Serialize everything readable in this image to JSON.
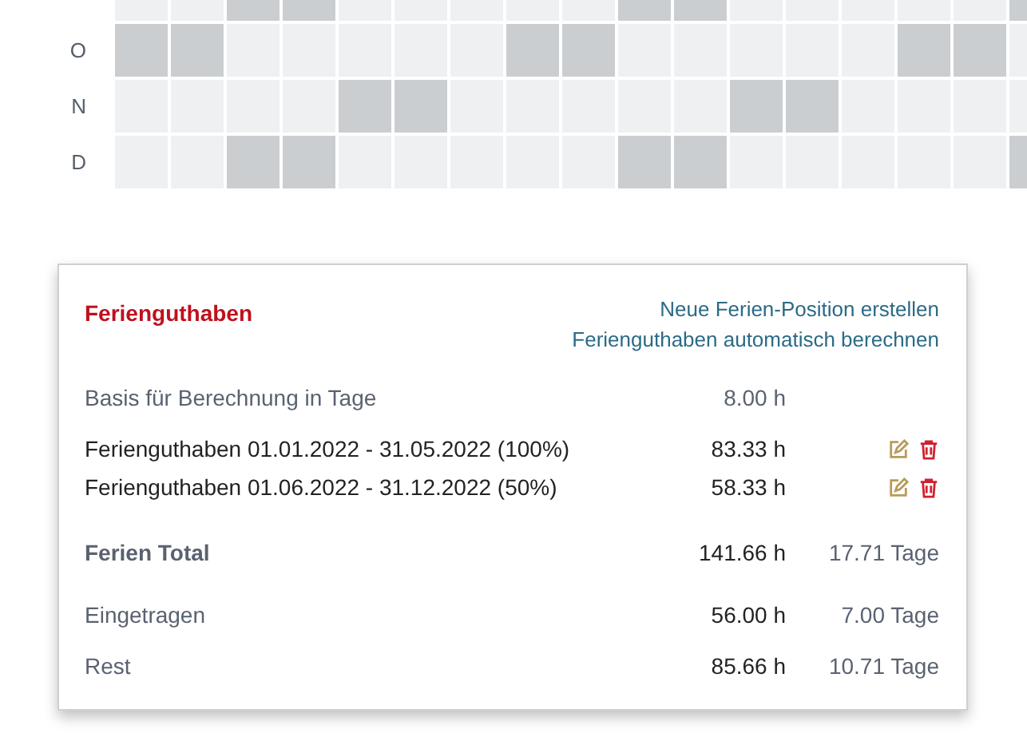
{
  "calendar": {
    "rows": [
      {
        "label": "",
        "cells": [
          false,
          false,
          true,
          true,
          false,
          false,
          false,
          false,
          false,
          true,
          true,
          false,
          false,
          false,
          false,
          false,
          true
        ]
      },
      {
        "label": "O",
        "cells": [
          true,
          true,
          false,
          false,
          false,
          false,
          false,
          true,
          true,
          false,
          false,
          false,
          false,
          false,
          true,
          true,
          false
        ]
      },
      {
        "label": "N",
        "cells": [
          false,
          false,
          false,
          false,
          true,
          true,
          false,
          false,
          false,
          false,
          false,
          true,
          true,
          false,
          false,
          false,
          false
        ]
      },
      {
        "label": "D",
        "cells": [
          false,
          false,
          true,
          true,
          false,
          false,
          false,
          false,
          false,
          true,
          true,
          false,
          false,
          false,
          false,
          false,
          true
        ]
      }
    ]
  },
  "card": {
    "title": "Ferienguthaben",
    "links": [
      "Neue Ferien-Position erstellen",
      "Ferienguthaben automatisch berechnen"
    ],
    "rows": [
      {
        "kind": "basis",
        "label": "Basis für Berechnung in Tage",
        "hours": "8.00 h"
      },
      {
        "kind": "entry",
        "label": "Ferienguthaben 01.01.2022 - 31.05.2022 (100%)",
        "hours": "83.33 h"
      },
      {
        "kind": "entry",
        "label": "Ferienguthaben 01.06.2022 - 31.12.2022 (50%)",
        "hours": "58.33 h"
      },
      {
        "kind": "total",
        "label": "Ferien Total",
        "hours": "141.66 h",
        "days": "17.71 Tage"
      },
      {
        "kind": "summary",
        "label": "Eingetragen",
        "hours": "56.00 h",
        "days": "7.00 Tage"
      },
      {
        "kind": "summary",
        "label": "Rest",
        "hours": "85.66 h",
        "days": "10.71 Tage"
      }
    ]
  }
}
